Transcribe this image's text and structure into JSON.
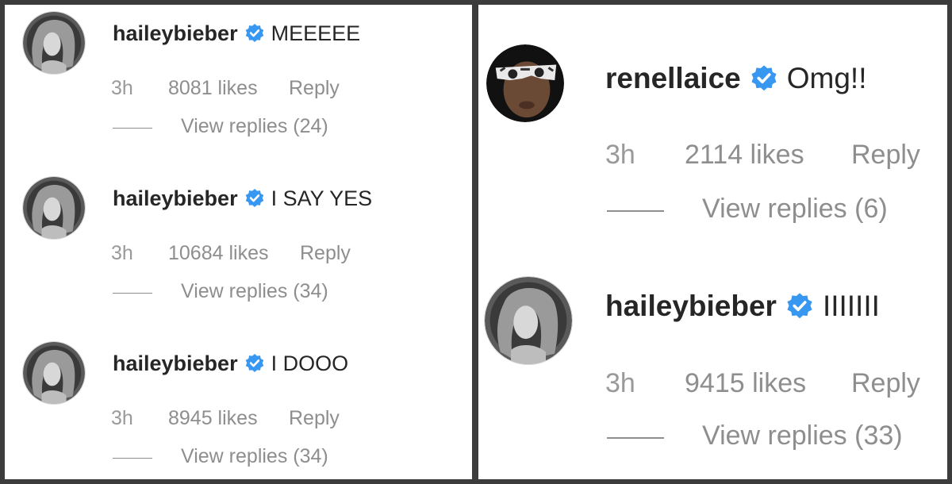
{
  "left_comments": [
    {
      "username": "haileybieber",
      "text": "MEEEEE",
      "time": "3h",
      "likes": "8081 likes",
      "reply": "Reply",
      "view_replies": "View replies (24)",
      "verified": true
    },
    {
      "username": "haileybieber",
      "text": "I SAY YES",
      "time": "3h",
      "likes": "10684 likes",
      "reply": "Reply",
      "view_replies": "View replies (34)",
      "verified": true
    },
    {
      "username": "haileybieber",
      "text": "I DOOO",
      "time": "3h",
      "likes": "8945 likes",
      "reply": "Reply",
      "view_replies": "View replies (34)",
      "verified": true
    }
  ],
  "right_comments": [
    {
      "username": "renellaice",
      "text": "Omg!!",
      "time": "3h",
      "likes": "2114 likes",
      "reply": "Reply",
      "view_replies": "View replies (6)",
      "verified": true
    },
    {
      "username": "haileybieber",
      "text": "IIIIIII",
      "time": "3h",
      "likes": "9415 likes",
      "reply": "Reply",
      "view_replies": "View replies (33)",
      "verified": true
    }
  ],
  "colors": {
    "verified_badge": "#3897f0",
    "username": "#262626",
    "secondary_text": "#8e8e8e",
    "border": "#3c3c3c"
  },
  "icons": {
    "verified": "verified-badge-icon",
    "avatar": "avatar-image"
  }
}
